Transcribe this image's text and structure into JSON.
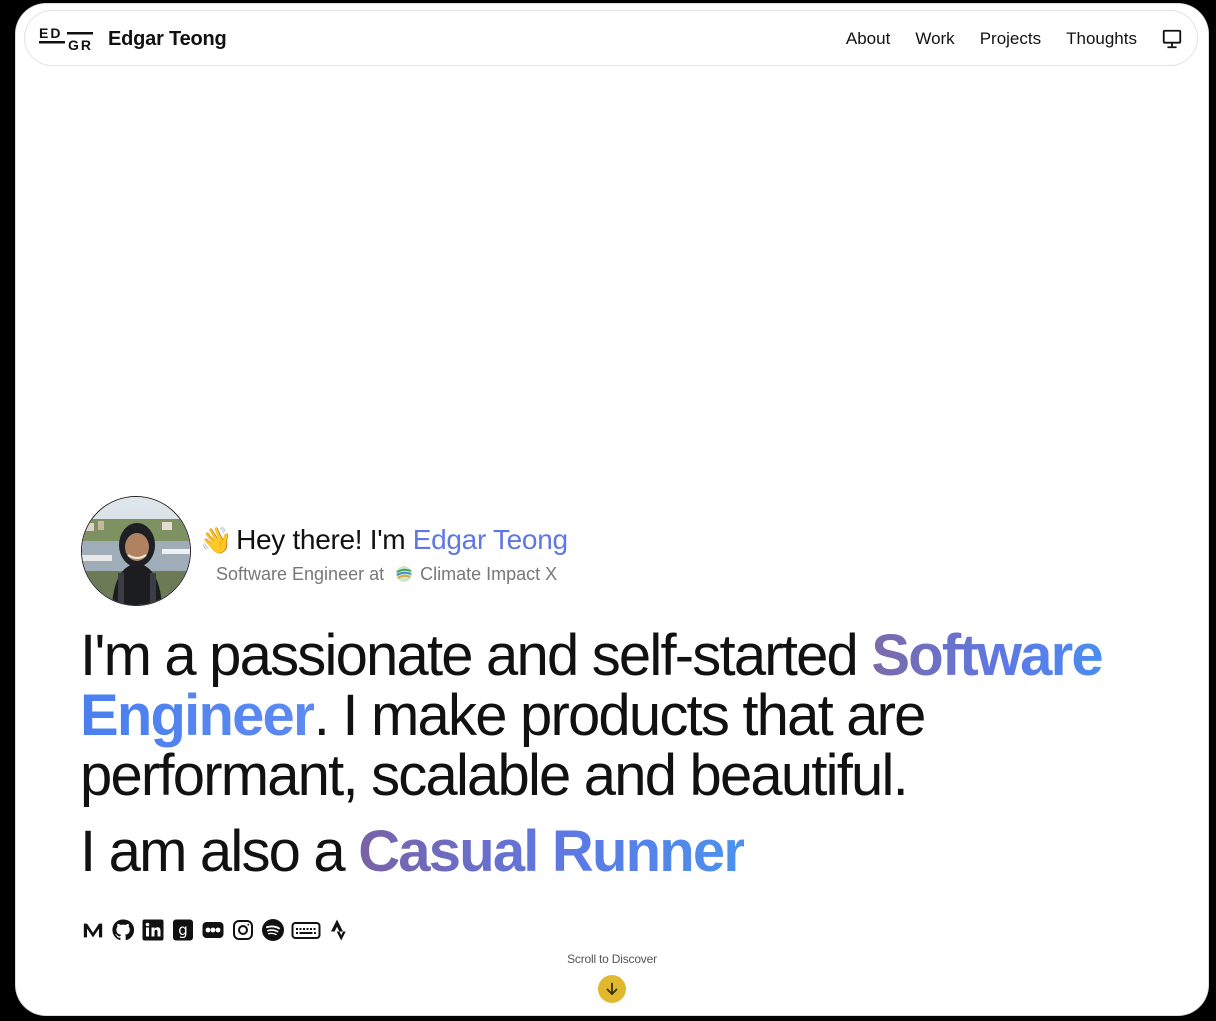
{
  "header": {
    "logo_text": "EDGR",
    "brand": "Edgar Teong",
    "nav": [
      {
        "label": "About"
      },
      {
        "label": "Work"
      },
      {
        "label": "Projects"
      },
      {
        "label": "Thoughts"
      }
    ],
    "theme_icon": "monitor-icon"
  },
  "intro": {
    "wave": "👋",
    "greeting": "Hey there! I'm ",
    "name": "Edgar Teong",
    "role_prefix": "Software Engineer at",
    "company": "Climate Impact X"
  },
  "headline": {
    "part1": "I'm a passionate and self-started ",
    "highlight1": "Software",
    "highlight2": "Engineer",
    "part2": ". I make products that are performant, scalable and beautiful.",
    "line2_prefix": "I am also a ",
    "line2_highlight": "Casual Runner"
  },
  "socials": [
    {
      "icon": "medium-icon"
    },
    {
      "icon": "github-icon"
    },
    {
      "icon": "linkedin-icon"
    },
    {
      "icon": "goodreads-icon"
    },
    {
      "icon": "letterboxd-icon"
    },
    {
      "icon": "instagram-icon"
    },
    {
      "icon": "spotify-icon"
    },
    {
      "icon": "monkeytype-icon"
    },
    {
      "icon": "strava-icon"
    }
  ],
  "scroll": {
    "label": "Scroll to Discover"
  },
  "colors": {
    "accent_blue": "#5f78e0",
    "accent_purple": "#7b6aa8",
    "scroll_button": "#e1b92e"
  }
}
